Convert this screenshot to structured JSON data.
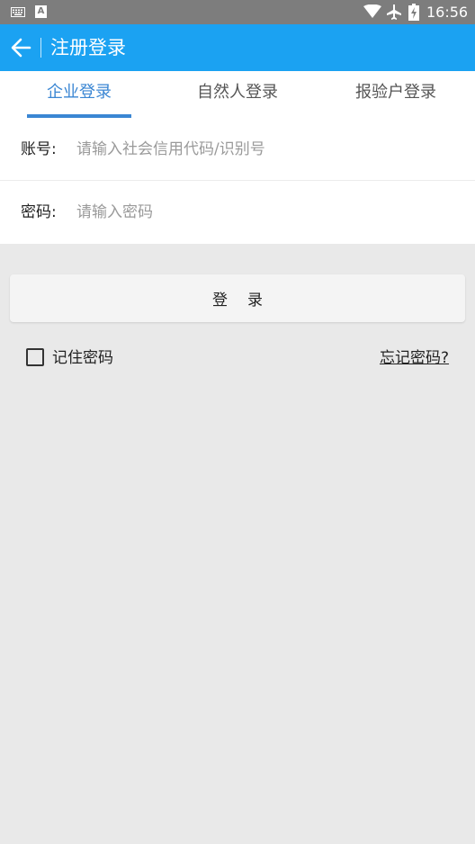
{
  "status_bar": {
    "time": "16:56",
    "a_icon_text": "A"
  },
  "app_bar": {
    "title": "注册登录"
  },
  "tabs": [
    {
      "label": "企业登录",
      "active": true
    },
    {
      "label": "自然人登录",
      "active": false
    },
    {
      "label": "报验户登录",
      "active": false
    }
  ],
  "form": {
    "account": {
      "label": "账号:",
      "placeholder": "请输入社会信用代码/识别号",
      "value": ""
    },
    "password": {
      "label": "密码:",
      "placeholder": "请输入密码",
      "value": ""
    }
  },
  "login_button": {
    "label": "登录"
  },
  "remember": {
    "label": "记住密码",
    "checked": false
  },
  "forgot": {
    "label": "忘记密码?"
  },
  "colors": {
    "app_bar": "#1ba2f2",
    "tab_active": "#3a86d3",
    "status_bar": "#7d7d7d",
    "background": "#e9e9e9"
  }
}
